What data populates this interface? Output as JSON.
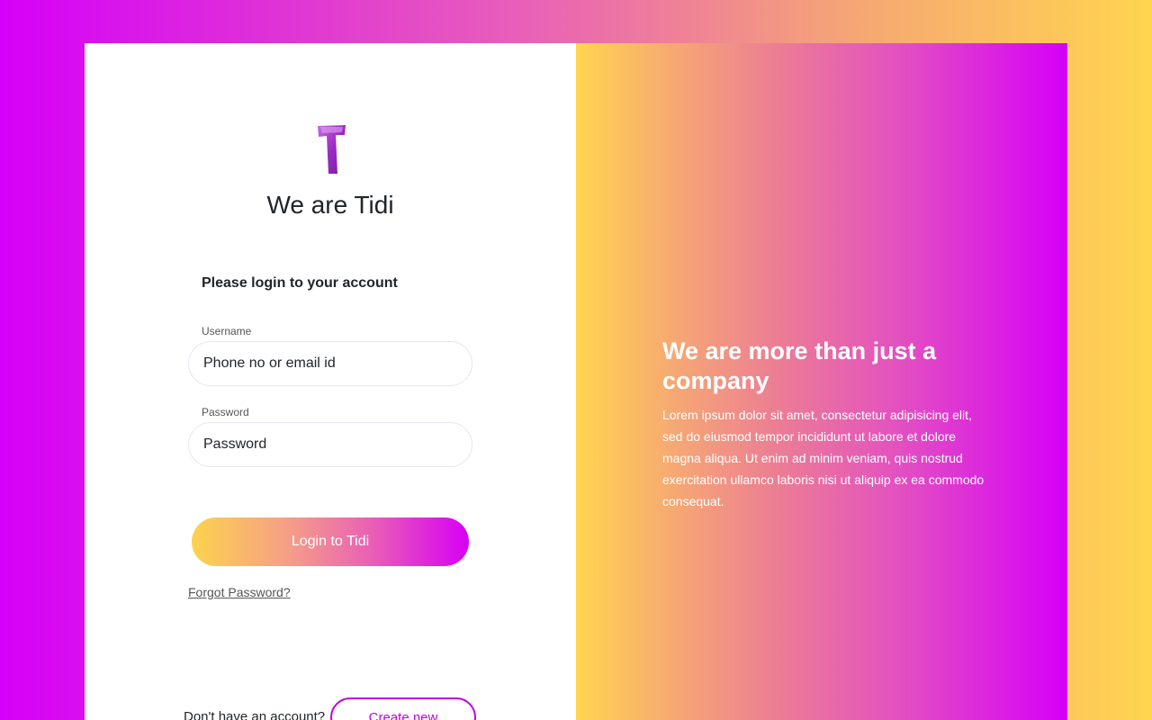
{
  "brand": {
    "title": "We are Tidi",
    "logo_icon": "letter-t-logo-icon"
  },
  "login": {
    "heading": "Please login to your account",
    "username_label": "Username",
    "username_placeholder": "Phone no or email id",
    "password_label": "Password",
    "password_placeholder": "Password",
    "submit_label": "Login to Tidi",
    "forgot_label": "Forgot Password?"
  },
  "signup": {
    "prompt": "Don't have an account?",
    "button_label": "Create new"
  },
  "promo": {
    "title": "We are more than just a company",
    "body": "Lorem ipsum dolor sit amet, consectetur adipisicing elit, sed do eiusmod tempor incididunt ut labore et dolore magna aliqua. Ut enim ad minim veniam, quis nostrud exercitation ullamco laboris nisi ut aliquip ex ea commodo consequat."
  },
  "colors": {
    "accent_magenta": "#d500f9",
    "accent_yellow": "#ffd54f",
    "text_dark": "#212529"
  }
}
